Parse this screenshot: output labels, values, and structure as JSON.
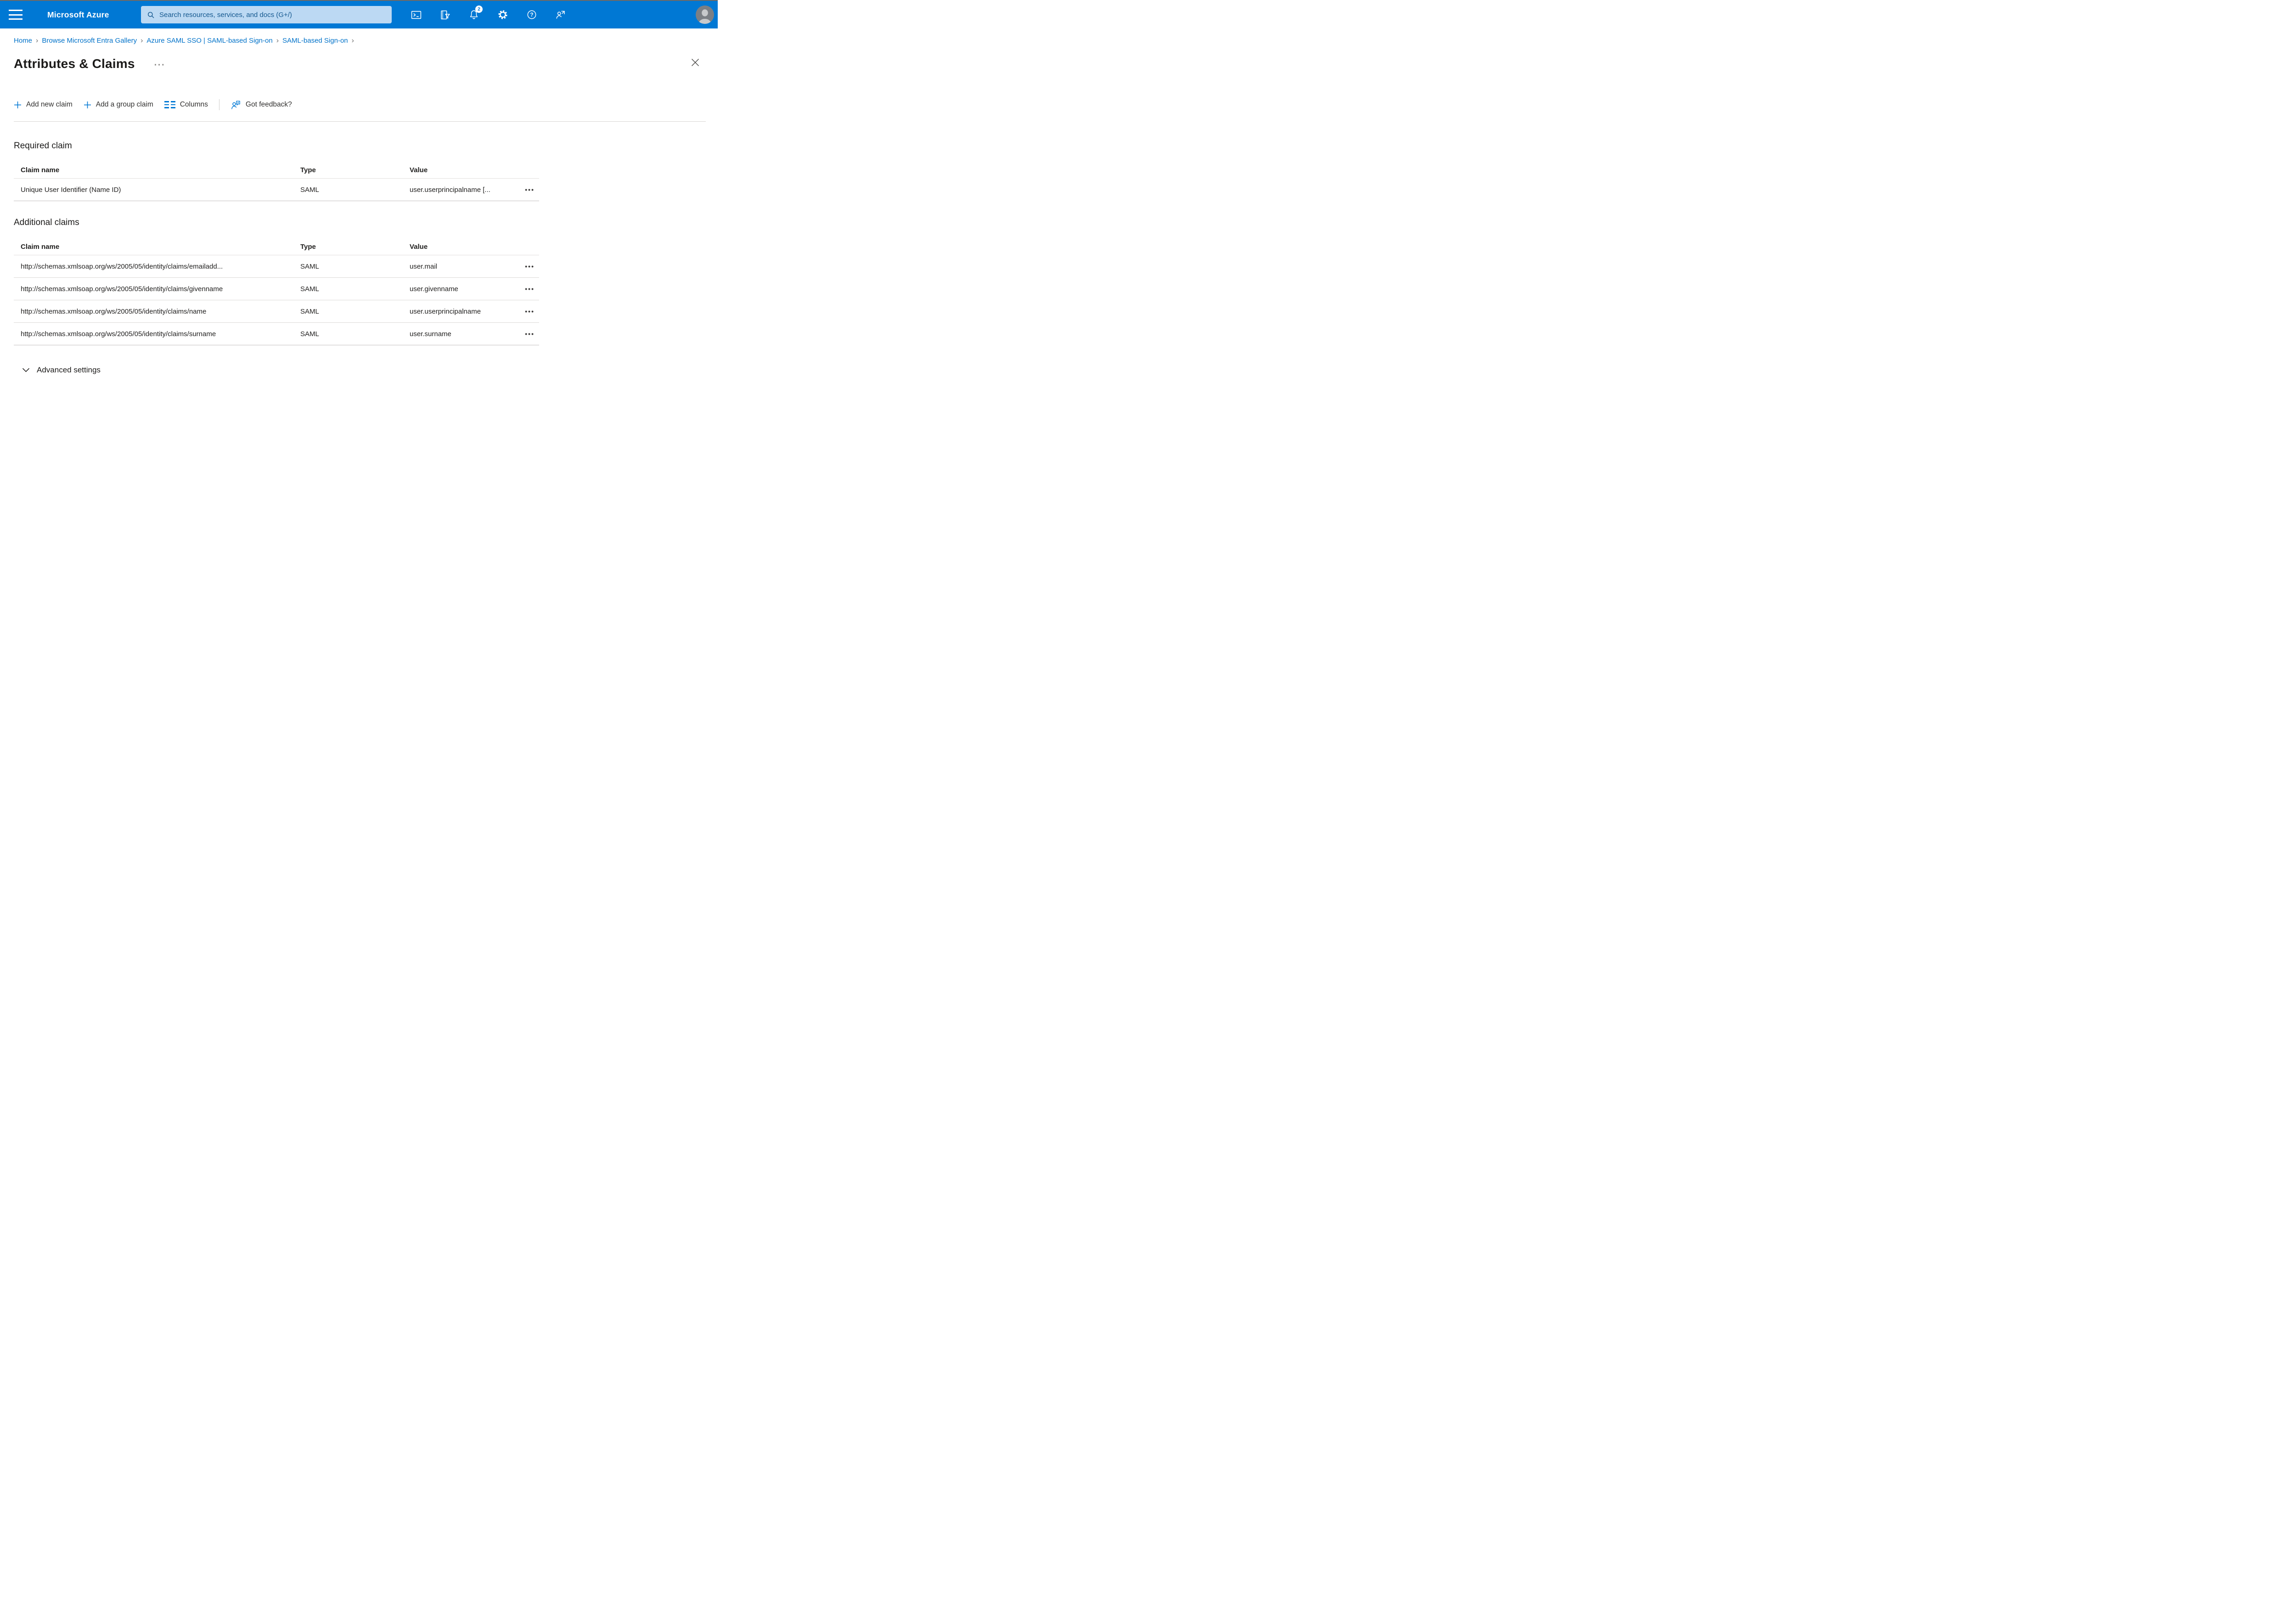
{
  "topbar": {
    "brand": "Microsoft Azure",
    "search_placeholder": "Search resources, services, and docs (G+/)",
    "notification_count": "2",
    "colors": {
      "bar": "#0078d4",
      "search_bg": "#bcd9f3",
      "search_text": "#14588f"
    }
  },
  "breadcrumb": {
    "items": [
      "Home",
      "Browse Microsoft Entra Gallery",
      "Azure SAML SSO | SAML-based Sign-on",
      "SAML-based Sign-on"
    ],
    "separator": "›"
  },
  "page": {
    "title": "Attributes & Claims"
  },
  "toolbar": {
    "add_new_claim": "Add new claim",
    "add_group_claim": "Add a group claim",
    "columns": "Columns",
    "got_feedback": "Got feedback?"
  },
  "required_claim": {
    "heading": "Required claim",
    "columns": {
      "name": "Claim name",
      "type": "Type",
      "value": "Value"
    },
    "rows": [
      {
        "name": "Unique User Identifier (Name ID)",
        "type": "SAML",
        "value": "user.userprincipalname [..."
      }
    ]
  },
  "additional_claims": {
    "heading": "Additional claims",
    "columns": {
      "name": "Claim name",
      "type": "Type",
      "value": "Value"
    },
    "rows": [
      {
        "name": "http://schemas.xmlsoap.org/ws/2005/05/identity/claims/emailadd...",
        "type": "SAML",
        "value": "user.mail"
      },
      {
        "name": "http://schemas.xmlsoap.org/ws/2005/05/identity/claims/givenname",
        "type": "SAML",
        "value": "user.givenname"
      },
      {
        "name": "http://schemas.xmlsoap.org/ws/2005/05/identity/claims/name",
        "type": "SAML",
        "value": "user.userprincipalname"
      },
      {
        "name": "http://schemas.xmlsoap.org/ws/2005/05/identity/claims/surname",
        "type": "SAML",
        "value": "user.surname"
      }
    ]
  },
  "advanced": {
    "label": "Advanced settings"
  },
  "glyphs": {
    "title_ellipsis": "···",
    "row_menu": "•••"
  },
  "colors": {
    "accent": "#0078d4",
    "link": "#0072c9",
    "text": "#1b1a19",
    "divider": "#d8d6d4"
  }
}
